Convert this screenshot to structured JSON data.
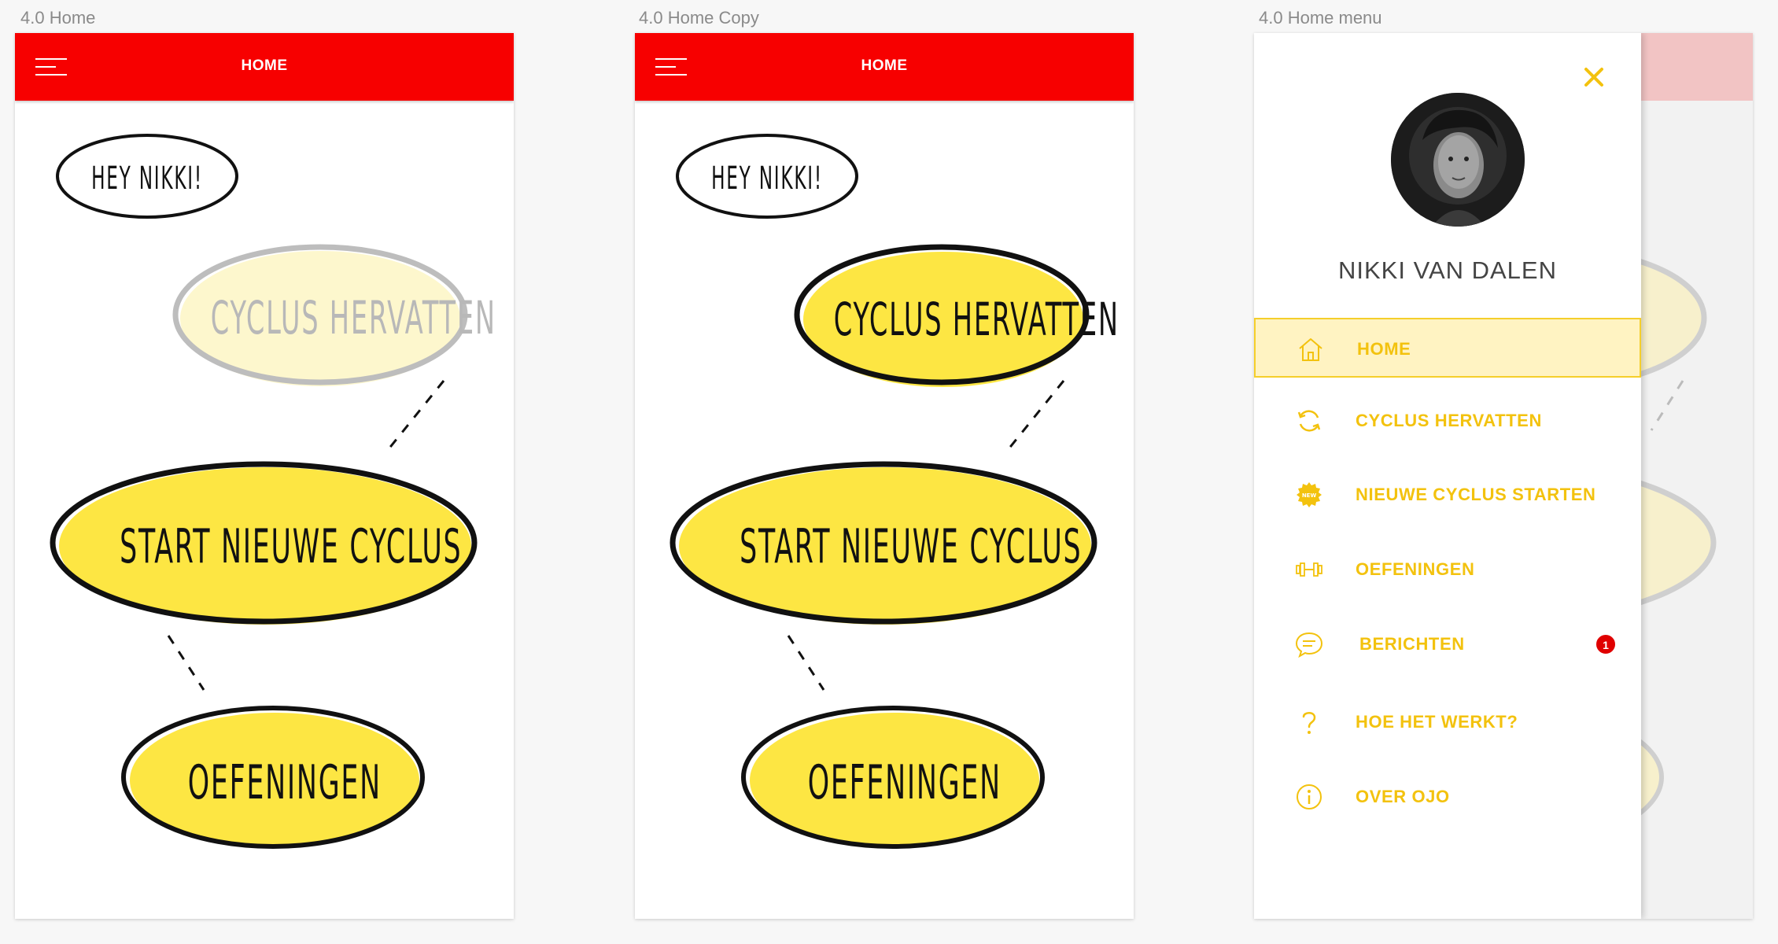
{
  "artboards": [
    {
      "label": "4.0 Home"
    },
    {
      "label": "4.0 Home Copy"
    },
    {
      "label": "4.0 Home menu"
    }
  ],
  "appbar": {
    "title": "HOME"
  },
  "home": {
    "greeting": "HEY NIKKI!",
    "resume": "CYCLUS HERVATTEN",
    "start": "START NIEUWE CYCLUS",
    "exercises": "OEFENINGEN"
  },
  "drawer": {
    "user_name": "NIKKI VAN DALEN",
    "items": [
      {
        "label": "HOME",
        "icon": "home-icon",
        "active": true
      },
      {
        "label": "CYCLUS HERVATTEN",
        "icon": "refresh-icon"
      },
      {
        "label": "NIEUWE CYCLUS STARTEN",
        "icon": "new-badge-icon"
      },
      {
        "label": "OEFENINGEN",
        "icon": "dumbbell-icon"
      },
      {
        "label": "BERICHTEN",
        "icon": "chat-bubble-icon",
        "badge": "1"
      },
      {
        "label": "HOE HET WERKT?",
        "icon": "question-icon"
      },
      {
        "label": "OVER OJO",
        "icon": "info-icon"
      }
    ],
    "new_badge_text": "NEW"
  },
  "colors": {
    "brand_red": "#f70000",
    "accent_yellow": "#f3c20e",
    "blob_yellow": "#fde643",
    "badge_red": "#e00000"
  }
}
